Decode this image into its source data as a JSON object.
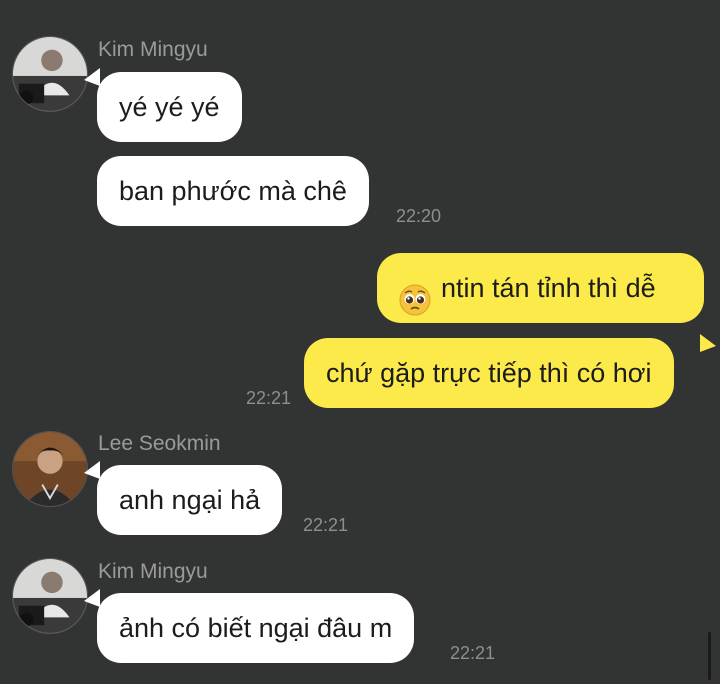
{
  "messages": [
    {
      "sender": "Kim Mingyu",
      "text": "yé yé yé",
      "time": ""
    },
    {
      "sender": "",
      "text": "ban phước mà chê",
      "time": "22:20"
    },
    {
      "sender": "",
      "text": "ntin tán tỉnh thì dễ",
      "emoji": "pleading-face-icon",
      "time": ""
    },
    {
      "sender": "",
      "text": "chứ gặp trực tiếp thì có hơi",
      "time": "22:21"
    },
    {
      "sender": "Lee Seokmin",
      "text": "anh ngại hả",
      "time": "22:21"
    },
    {
      "sender": "Kim Mingyu",
      "text": "ảnh có biết ngại đâu m",
      "time": "22:21"
    }
  ],
  "colors": {
    "background": "#323333",
    "incoming_bubble": "#ffffff",
    "outgoing_bubble": "#fce94a",
    "sender_name": "#9a9a9a",
    "timestamp": "#8e8e8e"
  }
}
